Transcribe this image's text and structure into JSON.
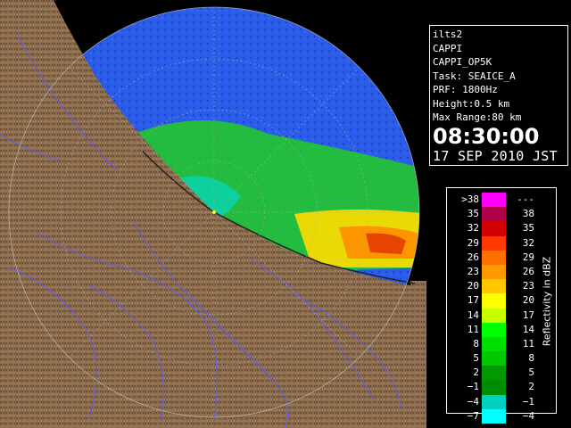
{
  "info": {
    "lines": [
      "ilts2",
      "CAPPI",
      "CAPPI_OP5K",
      "Task: SEAICE_A",
      "PRF: 1800Hz",
      "Height:0.5 km",
      "Max Range:80 km"
    ],
    "time": "08:30:00",
    "date": "17 SEP 2010 JST"
  },
  "legend": {
    "title": "Reflectivity in dBZ",
    "rows": [
      {
        "lo": ">38",
        "hi": "---",
        "color": "#ff00ff"
      },
      {
        "lo": "35",
        "hi": "38",
        "color": "#b0004a"
      },
      {
        "lo": "32",
        "hi": "35",
        "color": "#d20000"
      },
      {
        "lo": "29",
        "hi": "32",
        "color": "#ff3a00"
      },
      {
        "lo": "26",
        "hi": "29",
        "color": "#ff7000"
      },
      {
        "lo": "23",
        "hi": "26",
        "color": "#ff9900"
      },
      {
        "lo": "20",
        "hi": "23",
        "color": "#ffc800"
      },
      {
        "lo": "17",
        "hi": "20",
        "color": "#ffff00"
      },
      {
        "lo": "14",
        "hi": "17",
        "color": "#c8ff00"
      },
      {
        "lo": "11",
        "hi": "14",
        "color": "#00ff00"
      },
      {
        "lo": "8",
        "hi": "11",
        "color": "#00e000"
      },
      {
        "lo": "5",
        "hi": "8",
        "color": "#00c800"
      },
      {
        "lo": "2",
        "hi": "5",
        "color": "#009a00"
      },
      {
        "lo": "−1",
        "hi": "2",
        "color": "#008c00"
      },
      {
        "lo": "−4",
        "hi": "−1",
        "color": "#00d0c0"
      },
      {
        "lo": "−7",
        "hi": "−4",
        "color": "#00ffff"
      }
    ]
  },
  "colors": {
    "radar_fill": "#2255ee",
    "land": "#8a6a4a",
    "rivers": "#5a5aff",
    "range_rings": "#888888"
  }
}
